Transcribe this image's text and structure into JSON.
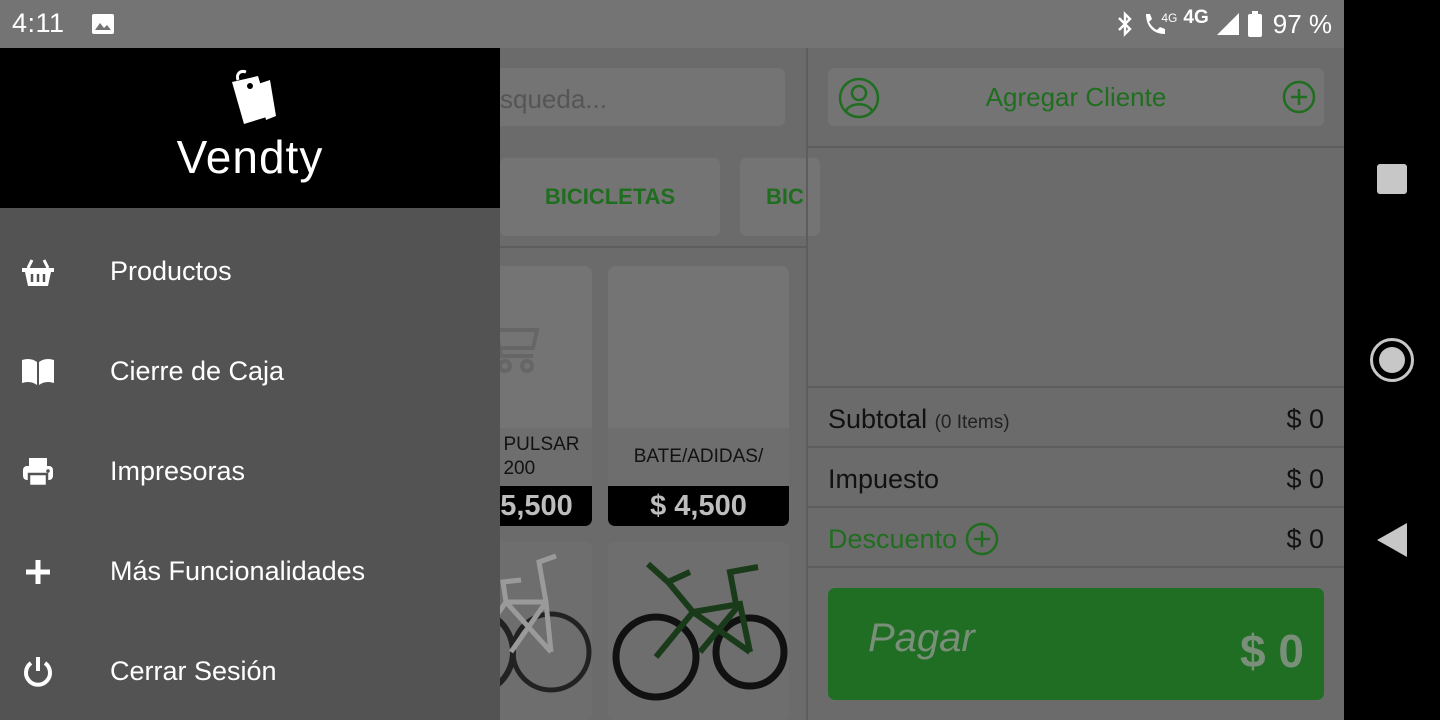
{
  "status_bar": {
    "time": "4:11",
    "network_primary": "4G",
    "network_secondary": "4G",
    "battery": "97 %"
  },
  "search": {
    "placeholder": "Búsqueda...",
    "visible_text": "squeda..."
  },
  "categories": [
    {
      "label": "BICICLETAS"
    },
    {
      "label": "BIC"
    }
  ],
  "products": [
    {
      "name_line1": "PULSAR",
      "name_line2": "200",
      "price": "5,500"
    },
    {
      "name": "BATE/ADIDAS/",
      "price": "$ 4,500"
    }
  ],
  "client": {
    "label": "Agregar Cliente"
  },
  "totals": {
    "subtotal_label": "Subtotal",
    "items_label": "(0 Items)",
    "subtotal_value": "$ 0",
    "tax_label": "Impuesto",
    "tax_value": "$ 0",
    "discount_label": "Descuento",
    "discount_value": "$ 0"
  },
  "pay": {
    "label": "Pagar",
    "amount": "$ 0"
  },
  "drawer": {
    "brand": "Vendty",
    "items": [
      {
        "label": "Productos",
        "icon": "basket-icon"
      },
      {
        "label": "Cierre de Caja",
        "icon": "book-icon"
      },
      {
        "label": "Impresoras",
        "icon": "printer-icon"
      },
      {
        "label": "Más Funcionalidades",
        "icon": "plus-icon"
      },
      {
        "label": "Cerrar Sesión",
        "icon": "power-icon"
      }
    ]
  },
  "colors": {
    "accent_green": "#1f6e23",
    "drawer_bg": "#535353",
    "header_bg": "#000000",
    "scrim": "#6b6b6b"
  }
}
